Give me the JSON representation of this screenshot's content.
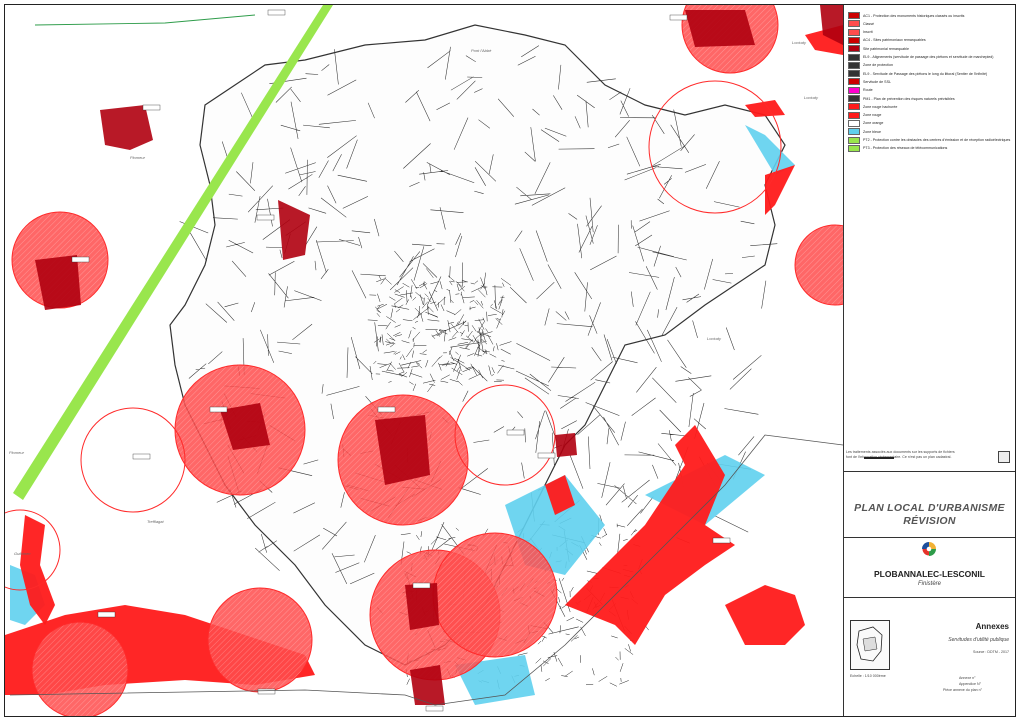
{
  "map": {
    "place_labels": [
      {
        "key": "pont_labbe",
        "text": "Pont l'Abbé"
      },
      {
        "key": "plomeur",
        "text": "Plomeur"
      },
      {
        "key": "loctudy_top",
        "text": "Loctudy"
      },
      {
        "key": "loctudy_right",
        "text": "Loctudy"
      },
      {
        "key": "loctudy_mid",
        "text": "Loctudy"
      },
      {
        "key": "treffiagat",
        "text": "Treffiagat"
      },
      {
        "key": "guilvinec",
        "text": "Guilvinec"
      },
      {
        "key": "plomeur_left",
        "text": "Plomeur"
      }
    ],
    "colors": {
      "protection_zone": "#ff4d4d",
      "monument": "#b00010",
      "flood_zone": "#ff1a1a",
      "blue_zone": "#5fd0ee",
      "ppr_band": "#99e64d",
      "road": "#333333"
    }
  },
  "legend": {
    "items": [
      {
        "key": "ac1",
        "label": "AC1 - Protection des monuments historiques classés ou inscrits",
        "color": "#cc0000"
      },
      {
        "key": "classe",
        "label": "Classé",
        "color": "#ff4d4d"
      },
      {
        "key": "inscrit",
        "label": "Inscrit",
        "color": "#ff4d4d"
      },
      {
        "key": "ac4",
        "label": "AC4 - Sites patrimoniaux remarquables",
        "color": "#cc0000"
      },
      {
        "key": "site_patri",
        "label": "Site patrimonial remarquable",
        "color": "#b00010"
      },
      {
        "key": "el9",
        "label": "EL9 - Alignements (servitude de passage des piétons et servitude de marchepied)",
        "color": "#333333"
      },
      {
        "key": "zone_protection",
        "label": "Zone de protection",
        "color": "#333333"
      },
      {
        "key": "el9b",
        "label": "EL9 - Servitude de Passage des piétons le long du littoral (Sentier de l'Infinité)",
        "color": "#333333"
      },
      {
        "key": "servitude",
        "label": "Servitude de SSL",
        "color": "#cc0000"
      },
      {
        "key": "route",
        "label": "Route",
        "color": "#ff00cc"
      },
      {
        "key": "pm1",
        "label": "PM1 - Plan de prévention des risques naturels prévisibles",
        "color": "#333333"
      },
      {
        "key": "zone_rouge_hachurees",
        "label": "Zone rouge hachurée",
        "color": "#ff1a1a"
      },
      {
        "key": "zone_rouge",
        "label": "Zone rouge",
        "color": "#ff1a1a"
      },
      {
        "key": "zone_orange",
        "label": "Zone orange",
        "color": "#ffffff"
      },
      {
        "key": "zone_bleue",
        "label": "Zone bleue",
        "color": "#5fd0ee"
      },
      {
        "key": "pt2",
        "label": "PT2 - Protection contre les obstacles des centres d'émission et de réception radioélectriques",
        "color": "#99e64d"
      },
      {
        "key": "pt3",
        "label": "PT3 - Protection des réseaux de télécommunications",
        "color": "#99e64d"
      }
    ],
    "disclaimer": "Les traitements associés aux documents sur les supports de fichiers font de l'information réglementaire. Ce n'est pas un plan cadastral."
  },
  "title": {
    "line1": "PLAN LOCAL D'URBANISME",
    "line2": "RÉVISION"
  },
  "commune": {
    "name": "PLOBANNALEC-LESCONIL",
    "department": "Finistère"
  },
  "annex": {
    "title": "Annexes",
    "subtitle": "Servitudes d'utilité publique",
    "source": "Source : DDTM - 2017",
    "scale": "Echelle : 1/10 000ème",
    "number": "Annexe n°",
    "appendix": "Appendice N°",
    "reference": "Pièce annexe du plan n°"
  }
}
